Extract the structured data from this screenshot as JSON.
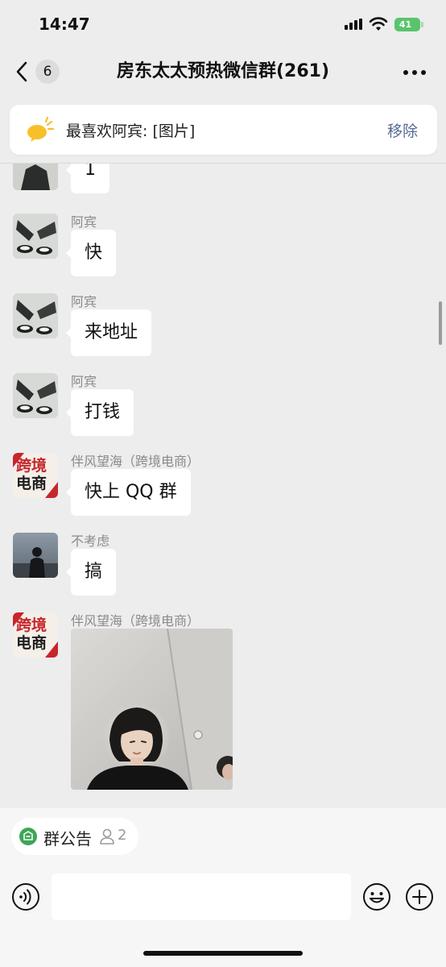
{
  "status_bar": {
    "time": "14:47",
    "battery": "41"
  },
  "nav": {
    "unread_count": "6",
    "title": "房东太太预热微信群(261)"
  },
  "pinned": {
    "text": "最喜欢阿宾: [图片]",
    "action": "移除"
  },
  "messages": [
    {
      "sender": "",
      "text": "1"
    },
    {
      "sender": "阿宾",
      "text": "快"
    },
    {
      "sender": "阿宾",
      "text": "来地址"
    },
    {
      "sender": "阿宾",
      "text": "打钱"
    },
    {
      "sender": "伴风望海（跨境电商）",
      "text": "快上 QQ 群",
      "avatar_text": [
        "跨境",
        "电商"
      ]
    },
    {
      "sender": "不考虑",
      "text": "搞"
    },
    {
      "sender": "伴风望海（跨境电商）",
      "text": "",
      "avatar_text": [
        "跨境",
        "电商"
      ],
      "image": "photo of a woman"
    }
  ],
  "bottom": {
    "notice_label": "群公告",
    "member_count": "2",
    "input_placeholder": ""
  },
  "colors": {
    "accent": "#576b95",
    "bubble": "#ffffff",
    "background": "#ededed",
    "notice_green": "#3aa757"
  }
}
